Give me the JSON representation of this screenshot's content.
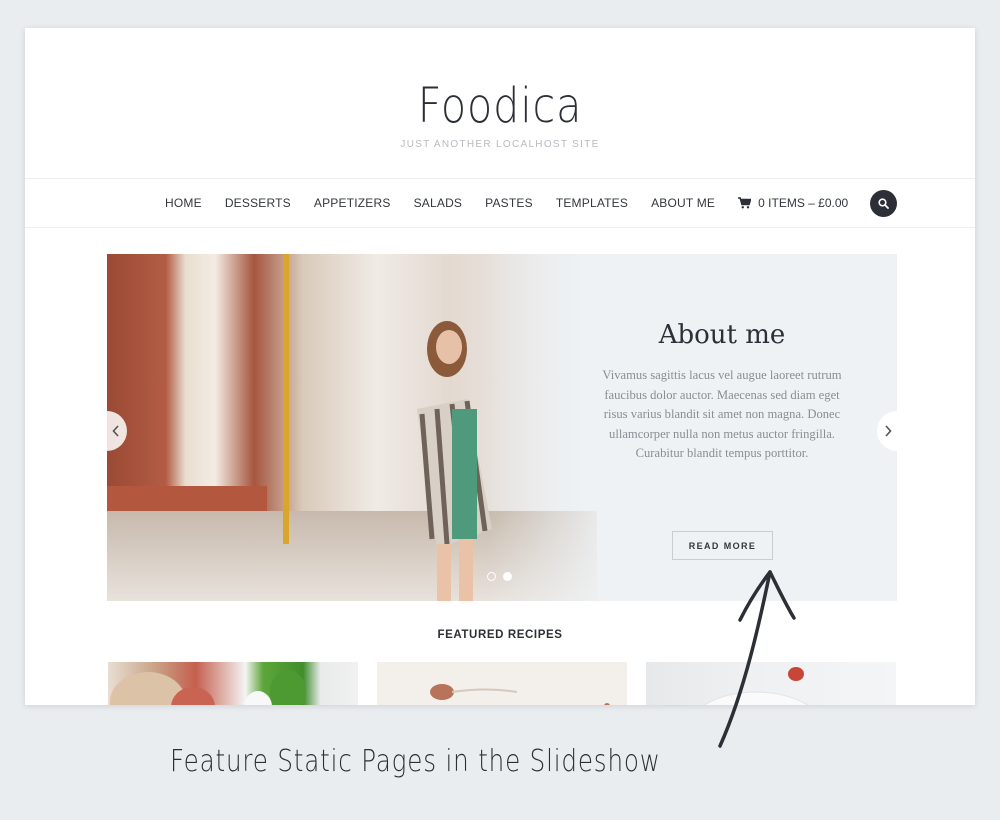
{
  "site": {
    "title": "Foodica",
    "tagline": "JUST ANOTHER LOCALHOST SITE"
  },
  "nav": {
    "items": [
      {
        "label": "HOME"
      },
      {
        "label": "DESSERTS"
      },
      {
        "label": "APPETIZERS"
      },
      {
        "label": "SALADS"
      },
      {
        "label": "PASTES"
      },
      {
        "label": "TEMPLATES"
      },
      {
        "label": "ABOUT ME"
      }
    ],
    "cart_label": "0 ITEMS – £0.00",
    "cart_icon": "shopping-cart-icon",
    "search_icon": "search-icon"
  },
  "slider": {
    "title": "About me",
    "text": "Vivamus sagittis lacus vel augue laoreet rutrum faucibus dolor auctor. Maecenas sed diam eget risus varius blandit sit amet non magna. Donec ullamcorper nulla non metus auctor fringilla. Curabitur blandit tempus porttitor.",
    "button_label": "READ MORE",
    "prev_icon": "chevron-left-icon",
    "next_icon": "chevron-right-icon",
    "slide_count": 2,
    "active_slide": 2
  },
  "featured": {
    "title": "FEATURED RECIPES",
    "recipes": [
      {
        "image": "bread-ham-basil-photo"
      },
      {
        "image": "spoons-nuts-photo"
      },
      {
        "image": "strawberry-plate-photo"
      }
    ]
  },
  "annotation": {
    "caption": "Feature Static Pages in the Slideshow"
  },
  "colors": {
    "background": "#e9edf0",
    "text_dark": "#2c2f36",
    "slider_panel": "#eef2f5",
    "muted_text": "#8a8d93"
  }
}
